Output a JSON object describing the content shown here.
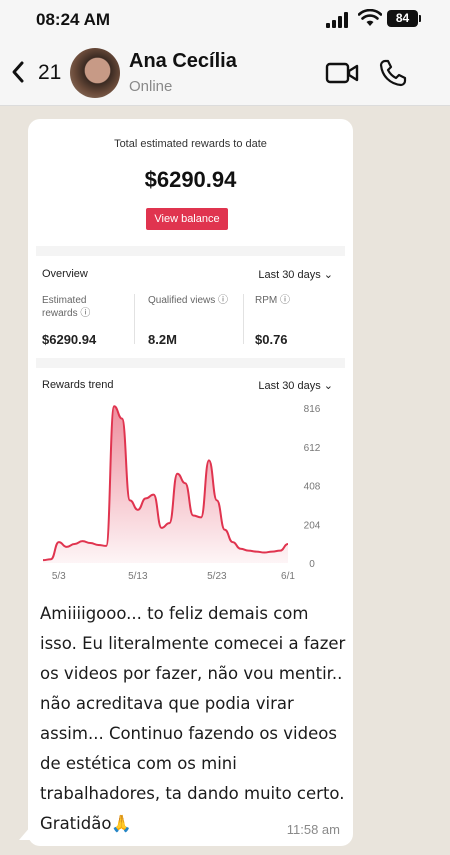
{
  "status_bar": {
    "time": "08:24 AM",
    "battery": "84"
  },
  "header": {
    "back_count": "21",
    "contact_name": "Ana Cecília",
    "contact_status": "Online"
  },
  "message": {
    "text": " Amiiiigooo... to feliz demais com isso. Eu literalmente comecei a fazer os videos por fazer, não vou mentir.. não acreditava que podia virar assim... Continuo fazendo os videos de estética com os mini trabalhadores, ta dando muito certo. Gratidão🙏",
    "time": "11:58 am"
  },
  "screenshot": {
    "rewards_title": "Total estimated rewards to date",
    "rewards_value": "$6290.94",
    "view_balance": "View balance",
    "overview_title": "Overview",
    "overview_period": "Last 30 days",
    "metrics": [
      {
        "label": "Estimated rewards",
        "value": "$6290.94"
      },
      {
        "label": "Qualified views",
        "value": "8.2M"
      },
      {
        "label": "RPM",
        "value": "$0.76"
      }
    ],
    "trend_title": "Rewards trend",
    "trend_period": "Last 30 days"
  },
  "chart_data": {
    "type": "area",
    "title": "Rewards trend",
    "x_ticks": [
      "5/3",
      "5/13",
      "5/23",
      "6/1"
    ],
    "y_ticks": [
      816,
      612,
      408,
      204,
      0
    ],
    "ylim": [
      0,
      816
    ],
    "color": "#e0344f",
    "series": [
      {
        "x": [
          "5/1",
          "5/2",
          "5/3",
          "5/4",
          "5/5",
          "5/6",
          "5/7",
          "5/8",
          "5/9",
          "5/10",
          "5/11",
          "5/12",
          "5/13",
          "5/14",
          "5/15",
          "5/16",
          "5/17",
          "5/18",
          "5/19",
          "5/20",
          "5/21",
          "5/22",
          "5/23",
          "5/24",
          "5/25",
          "5/26",
          "5/27",
          "5/28",
          "5/29",
          "5/30",
          "5/31",
          "6/1"
        ],
        "values": [
          15,
          20,
          110,
          85,
          100,
          115,
          105,
          95,
          90,
          825,
          760,
          330,
          280,
          340,
          360,
          185,
          210,
          470,
          420,
          250,
          240,
          540,
          330,
          175,
          110,
          75,
          65,
          60,
          55,
          60,
          65,
          100
        ]
      }
    ],
    "y_axis_side": "right",
    "grid": false
  },
  "colors": {
    "accent": "#e0344f",
    "bubble": "#ffffff",
    "wallpaper": "#e9e4dc"
  }
}
